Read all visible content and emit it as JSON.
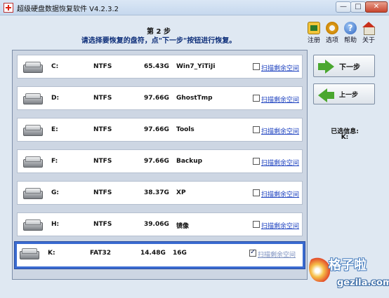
{
  "window": {
    "title": "超级硬盘数据恢复软件 V4.2.3.2",
    "min_label": "—",
    "max_label": "□",
    "close_label": "✕"
  },
  "header": {
    "step": "第 2 步",
    "instruction": "请选择要恢复的盘符，点\"下一步\"按钮进行恢复。"
  },
  "toolbar": {
    "register": "注册",
    "options": "选项",
    "help": "帮助",
    "about": "关于",
    "help_glyph": "?"
  },
  "partitions": [
    {
      "drive": "C:",
      "fs": "NTFS",
      "size": "65.43G",
      "label": "Win7_YiTiJi",
      "scan_label": "扫描剩余空间",
      "checked": false
    },
    {
      "drive": "D:",
      "fs": "NTFS",
      "size": "97.66G",
      "label": "GhostTmp",
      "scan_label": "扫描剩余空间",
      "checked": false
    },
    {
      "drive": "E:",
      "fs": "NTFS",
      "size": "97.66G",
      "label": "Tools",
      "scan_label": "扫描剩余空间",
      "checked": false
    },
    {
      "drive": "F:",
      "fs": "NTFS",
      "size": "97.66G",
      "label": "Backup",
      "scan_label": "扫描剩余空间",
      "checked": false
    },
    {
      "drive": "G:",
      "fs": "NTFS",
      "size": "38.37G",
      "label": "XP",
      "scan_label": "扫描剩余空间",
      "checked": false
    },
    {
      "drive": "H:",
      "fs": "NTFS",
      "size": "39.06G",
      "label": "镜像",
      "scan_label": "扫描剩余空间",
      "checked": false
    },
    {
      "drive": "K:",
      "fs": "FAT32",
      "size": "14.48G",
      "label": "16G",
      "scan_label": "扫描剩余空间",
      "checked": true,
      "selected": true
    }
  ],
  "nav": {
    "next": "下一步",
    "prev": "上一步"
  },
  "selection": {
    "label": "已选信息:",
    "value": "K:"
  },
  "watermark": {
    "brand": "格子啦",
    "site": "gezila.com"
  }
}
